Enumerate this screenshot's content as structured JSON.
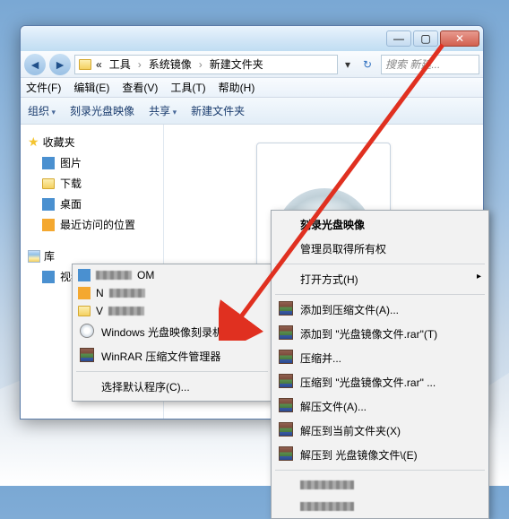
{
  "titlebar": {
    "min": "—",
    "max": "▢",
    "close": "✕"
  },
  "nav": {
    "back": "◄",
    "fwd": "►",
    "breadcrumb": {
      "bc1": "«",
      "bc2": "工具",
      "bc3": "系统镜像",
      "bc4": "新建文件夹",
      "sep": "›"
    },
    "refresh": "↻",
    "search_placeholder": "搜索 新建..."
  },
  "menubar": {
    "file": "文件(F)",
    "edit": "编辑(E)",
    "view": "查看(V)",
    "tools": "工具(T)",
    "help": "帮助(H)"
  },
  "toolbar": {
    "organize": "组织",
    "burn": "刻录光盘映像",
    "share": "共享",
    "newfolder": "新建文件夹"
  },
  "sidebar": {
    "fav": {
      "header": "收藏夹",
      "items": [
        "图片",
        "下载",
        "桌面",
        "最近访问的位置"
      ]
    },
    "lib": {
      "header": "库",
      "items": [
        "视频"
      ]
    }
  },
  "open_with_menu": {
    "app1": "Windows 光盘映像刻录机",
    "app2": "WinRAR 压缩文件管理器",
    "choose": "选择默认程序(C)..."
  },
  "context_menu": {
    "burn_title": "刻录光盘映像",
    "admin": "管理员取得所有权",
    "open_with": "打开方式(H)",
    "add_archive": "添加到压缩文件(A)...",
    "add_rar": "添加到 \"光盘镜像文件.rar\"(T)",
    "compress_mail": "压缩并...",
    "compress_to_rar": "压缩到 \"光盘镜像文件.rar\" ...",
    "extract": "解压文件(A)...",
    "extract_here": "解压到当前文件夹(X)",
    "extract_to": "解压到 光盘镜像文件\\(E)"
  }
}
